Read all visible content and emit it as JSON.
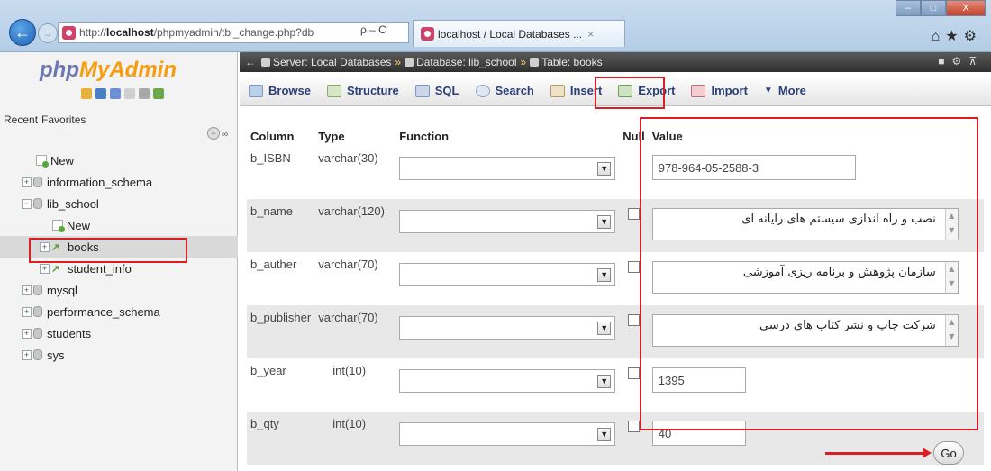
{
  "browser": {
    "url_prefix": "http://",
    "url_host": "localhost",
    "url_path": "/phpmyadmin/tbl_change.php?db",
    "url_controls": "ρ – C",
    "tab_title": "localhost / Local Databases ...",
    "tab_close": "×",
    "toolbar_icons": "⌂★⚙",
    "window_buttons": [
      "–",
      "□",
      "X"
    ]
  },
  "sidebar": {
    "logo_part1": "php",
    "logo_part2": "MyAdmin",
    "recent_label": "Recent",
    "favorites_label": "Favorites",
    "tree": [
      {
        "label": "New",
        "kind": "new",
        "indent": 0
      },
      {
        "label": "information_schema",
        "kind": "db",
        "indent": 0
      },
      {
        "label": "lib_school",
        "kind": "db",
        "indent": 0,
        "expanded": true
      },
      {
        "label": "New",
        "kind": "new",
        "indent": 1
      },
      {
        "label": "books",
        "kind": "table",
        "indent": 1,
        "selected": true
      },
      {
        "label": "student_info",
        "kind": "table",
        "indent": 1
      },
      {
        "label": "mysql",
        "kind": "db",
        "indent": 0
      },
      {
        "label": "performance_schema",
        "kind": "db",
        "indent": 0
      },
      {
        "label": "students",
        "kind": "db",
        "indent": 0
      },
      {
        "label": "sys",
        "kind": "db",
        "indent": 0
      }
    ]
  },
  "breadcrumb": {
    "server": "Server: Local Databases",
    "database": "Database: lib_school",
    "table": "Table: books"
  },
  "menu": {
    "browse": "Browse",
    "structure": "Structure",
    "sql": "SQL",
    "search": "Search",
    "insert": "Insert",
    "export": "Export",
    "import": "Import",
    "more": "More"
  },
  "table": {
    "headers": {
      "column": "Column",
      "type": "Type",
      "function": "Function",
      "null": "Null",
      "value": "Value"
    },
    "rows": [
      {
        "column": "b_ISBN",
        "type": "varchar(30)",
        "value": "978-964-05-2588-3",
        "has_null": false
      },
      {
        "column": "b_name",
        "type": "varchar(120)",
        "value": "نصب و راه اندازی سیستم های رایانه ای",
        "has_null": true
      },
      {
        "column": "b_auther",
        "type": "varchar(70)",
        "value": "سازمان پژوهش و برنامه ریزی آموزشی",
        "has_null": true
      },
      {
        "column": "b_publisher",
        "type": "varchar(70)",
        "value": "شرکت چاپ و نشر کتاب های درسی",
        "has_null": true
      },
      {
        "column": "b_year",
        "type": "int(10)",
        "value": "1395",
        "has_null": true
      },
      {
        "column": "b_qty",
        "type": "int(10)",
        "value": "40",
        "has_null": true
      }
    ]
  },
  "go_label": "Go",
  "colors": {
    "highlight": "#d81f26",
    "menu_text": "#2a3f7a",
    "logo_blue": "#6c78af",
    "logo_orange": "#f89c0e"
  }
}
